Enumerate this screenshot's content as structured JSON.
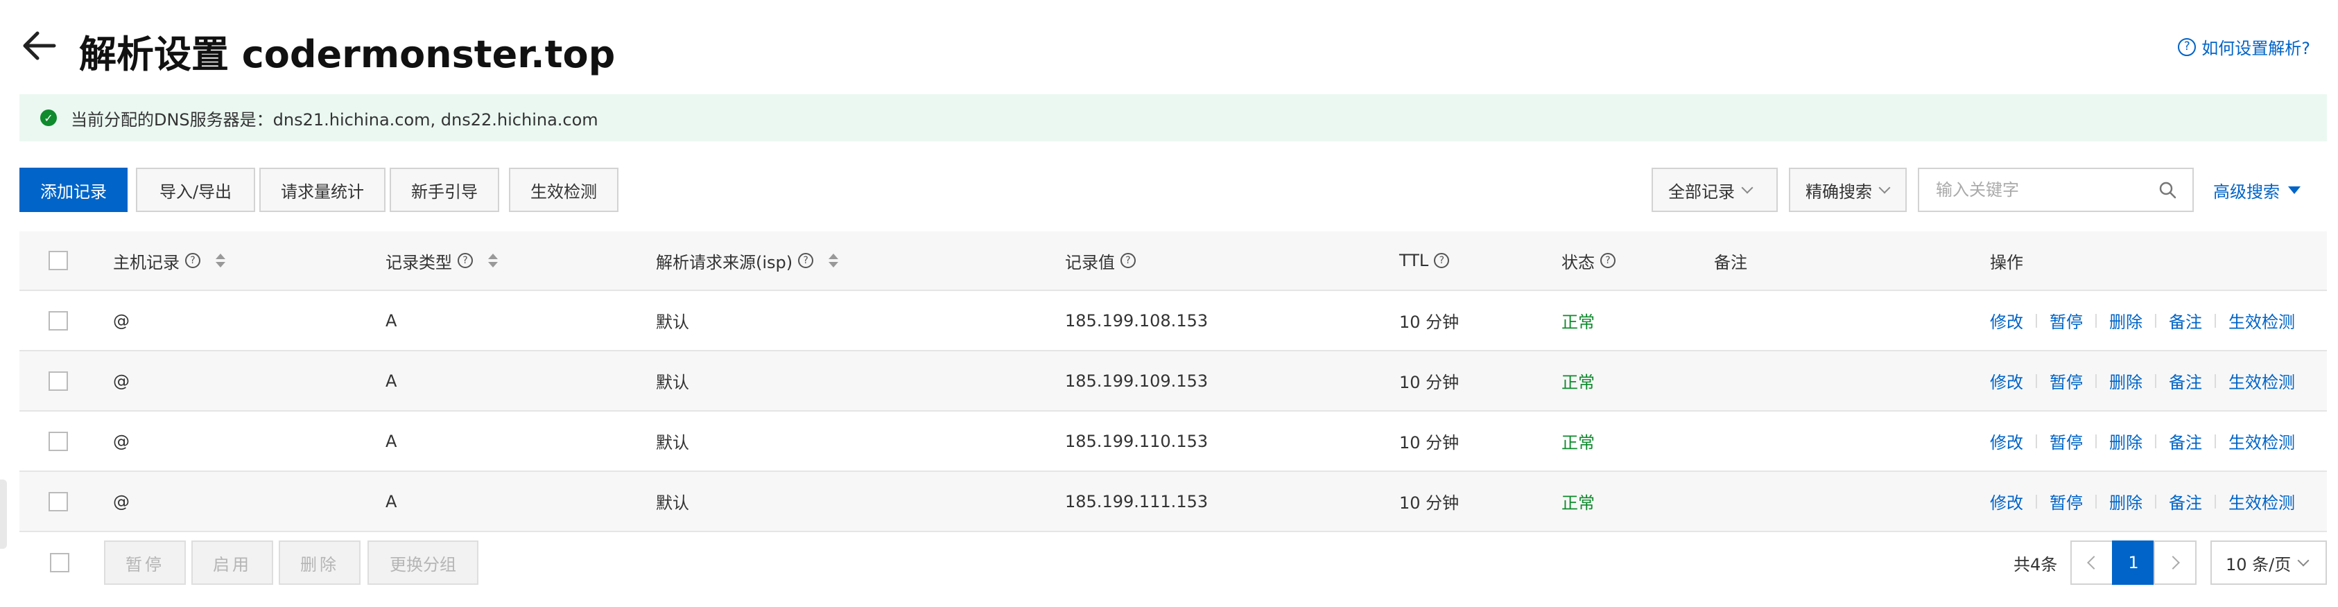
{
  "header": {
    "title": "解析设置 codermonster.top",
    "help_link": "如何设置解析?"
  },
  "banner": {
    "text": "当前分配的DNS服务器是：dns21.hichina.com, dns22.hichina.com"
  },
  "toolbar": {
    "add_record": "添加记录",
    "import_export": "导入/导出",
    "request_stats": "请求量统计",
    "beginner_guide": "新手引导",
    "effect_check": "生效检测",
    "record_filter": "全部记录",
    "search_mode": "精确搜索",
    "search_placeholder": "输入关键字",
    "advanced_search": "高级搜索"
  },
  "table": {
    "headers": {
      "host": "主机记录",
      "type": "记录类型",
      "isp": "解析请求来源(isp)",
      "value": "记录值",
      "ttl": "TTL",
      "status": "状态",
      "remark": "备注",
      "actions": "操作"
    },
    "action_labels": [
      "修改",
      "暂停",
      "删除",
      "备注",
      "生效检测"
    ],
    "rows": [
      {
        "host": "@",
        "type": "A",
        "isp": "默认",
        "value": "185.199.108.153",
        "ttl": "10 分钟",
        "status": "正常",
        "remark": ""
      },
      {
        "host": "@",
        "type": "A",
        "isp": "默认",
        "value": "185.199.109.153",
        "ttl": "10 分钟",
        "status": "正常",
        "remark": ""
      },
      {
        "host": "@",
        "type": "A",
        "isp": "默认",
        "value": "185.199.110.153",
        "ttl": "10 分钟",
        "status": "正常",
        "remark": ""
      },
      {
        "host": "@",
        "type": "A",
        "isp": "默认",
        "value": "185.199.111.153",
        "ttl": "10 分钟",
        "status": "正常",
        "remark": ""
      }
    ]
  },
  "footer": {
    "pause": "暂停",
    "enable": "启用",
    "delete": "删除",
    "change_group": "更换分组",
    "total": "共4条",
    "current_page": "1",
    "page_size": "10 条/页"
  },
  "colors": {
    "primary": "#0064c8",
    "success": "#0f8a2d",
    "banner_bg": "#ebf8f2"
  }
}
